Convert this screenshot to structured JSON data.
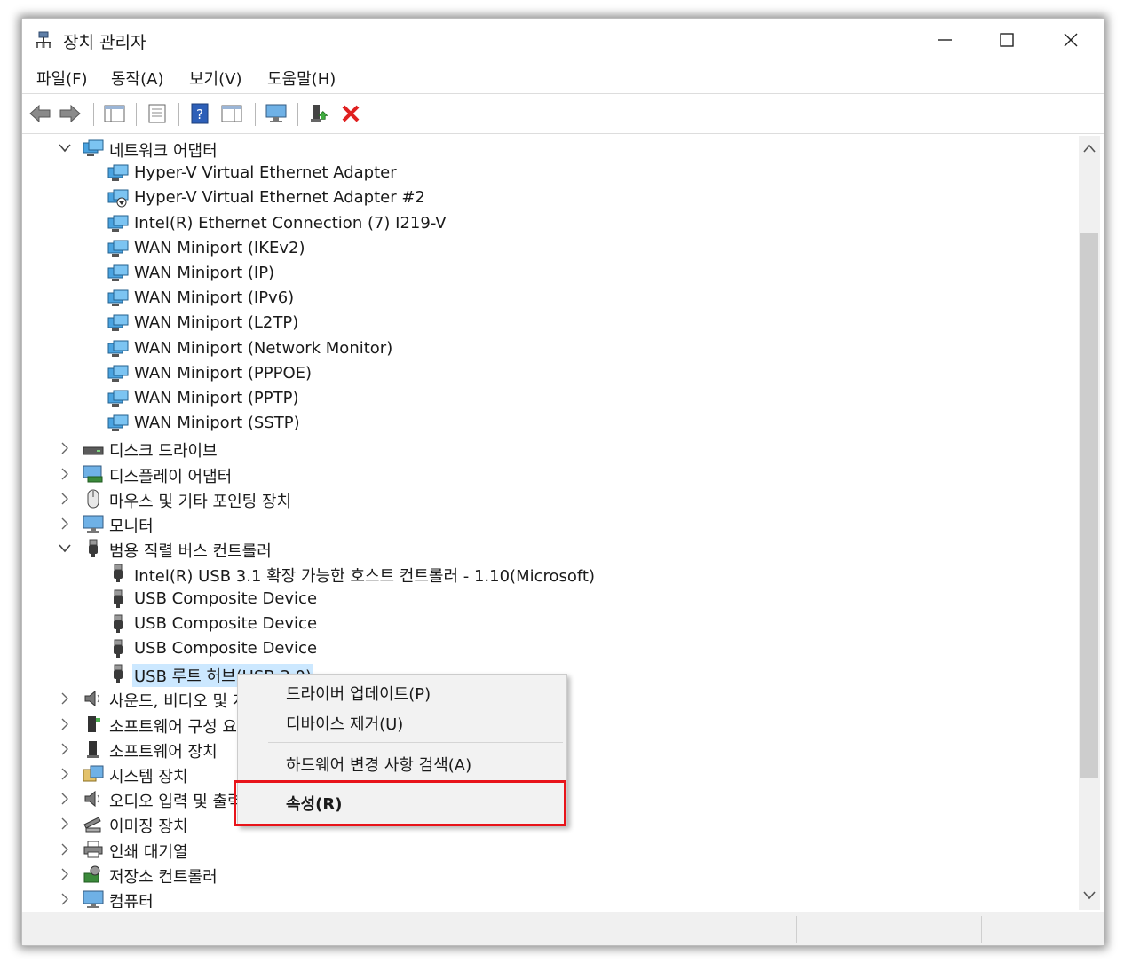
{
  "window": {
    "title": "장치 관리자"
  },
  "menu": [
    "파일(F)",
    "동작(A)",
    "보기(V)",
    "도움말(H)"
  ],
  "toolbar": {
    "icons": [
      "back-arrow-icon",
      "forward-arrow-icon",
      "show-hide-tree-icon",
      "properties-icon",
      "help-icon",
      "action-pane-icon",
      "scan-monitor-icon",
      "enable-device-icon",
      "uninstall-x-icon"
    ]
  },
  "tree": {
    "rows": [
      {
        "label": "네트워크 어댑터",
        "level": 1,
        "expander": "down",
        "icon": "network-adapter"
      },
      {
        "label": "Hyper-V Virtual Ethernet Adapter",
        "level": 2,
        "icon": "network-adapter"
      },
      {
        "label": "Hyper-V Virtual Ethernet Adapter #2",
        "level": 2,
        "icon": "network-adapter-down"
      },
      {
        "label": "Intel(R) Ethernet Connection (7) I219-V",
        "level": 2,
        "icon": "network-adapter"
      },
      {
        "label": "WAN Miniport (IKEv2)",
        "level": 2,
        "icon": "network-adapter"
      },
      {
        "label": "WAN Miniport (IP)",
        "level": 2,
        "icon": "network-adapter"
      },
      {
        "label": "WAN Miniport (IPv6)",
        "level": 2,
        "icon": "network-adapter"
      },
      {
        "label": "WAN Miniport (L2TP)",
        "level": 2,
        "icon": "network-adapter"
      },
      {
        "label": "WAN Miniport (Network Monitor)",
        "level": 2,
        "icon": "network-adapter"
      },
      {
        "label": "WAN Miniport (PPPOE)",
        "level": 2,
        "icon": "network-adapter"
      },
      {
        "label": "WAN Miniport (PPTP)",
        "level": 2,
        "icon": "network-adapter"
      },
      {
        "label": "WAN Miniport (SSTP)",
        "level": 2,
        "icon": "network-adapter"
      },
      {
        "label": "디스크 드라이브",
        "level": 1,
        "expander": "right",
        "icon": "disk-drive"
      },
      {
        "label": "디스플레이 어댑터",
        "level": 1,
        "expander": "right",
        "icon": "display-adapter"
      },
      {
        "label": "마우스 및 기타 포인팅 장치",
        "level": 1,
        "expander": "right",
        "icon": "mouse"
      },
      {
        "label": "모니터",
        "level": 1,
        "expander": "right",
        "icon": "monitor"
      },
      {
        "label": "범용 직렬 버스 컨트롤러",
        "level": 1,
        "expander": "down",
        "icon": "usb"
      },
      {
        "label": "Intel(R) USB 3.1 확장 가능한 호스트 컨트롤러 - 1.10(Microsoft)",
        "level": 2,
        "icon": "usb"
      },
      {
        "label": "USB Composite Device",
        "level": 2,
        "icon": "usb"
      },
      {
        "label": "USB Composite Device",
        "level": 2,
        "icon": "usb"
      },
      {
        "label": "USB Composite Device",
        "level": 2,
        "icon": "usb"
      },
      {
        "label": "USB 루트 허브(USB 3.0)",
        "level": 2,
        "icon": "usb",
        "selected": true
      },
      {
        "label": "사운드, 비디오 및 게임 컨트롤러",
        "level": 1,
        "expander": "right",
        "icon": "speaker"
      },
      {
        "label": "소프트웨어 구성 요소",
        "level": 1,
        "expander": "right",
        "icon": "software-component"
      },
      {
        "label": "소프트웨어 장치",
        "level": 1,
        "expander": "right",
        "icon": "software-device"
      },
      {
        "label": "시스템 장치",
        "level": 1,
        "expander": "right",
        "icon": "system-device"
      },
      {
        "label": "오디오 입력 및 출력",
        "level": 1,
        "expander": "right",
        "icon": "speaker"
      },
      {
        "label": "이미징 장치",
        "level": 1,
        "expander": "right",
        "icon": "imaging"
      },
      {
        "label": "인쇄 대기열",
        "level": 1,
        "expander": "right",
        "icon": "printer"
      },
      {
        "label": "저장소 컨트롤러",
        "level": 1,
        "expander": "right",
        "icon": "storage-controller"
      },
      {
        "label": "컴퓨터",
        "level": 1,
        "expander": "right",
        "icon": "monitor"
      }
    ]
  },
  "context_menu": {
    "items": [
      "드라이버 업데이트(P)",
      "디바이스 제거(U)",
      "하드웨어 변경 사항 검색(A)",
      "속성(R)"
    ]
  },
  "colors": {
    "selection": "#cce8ff",
    "highlight_box": "#e8141a",
    "menu_bg": "#f2f2f2"
  }
}
